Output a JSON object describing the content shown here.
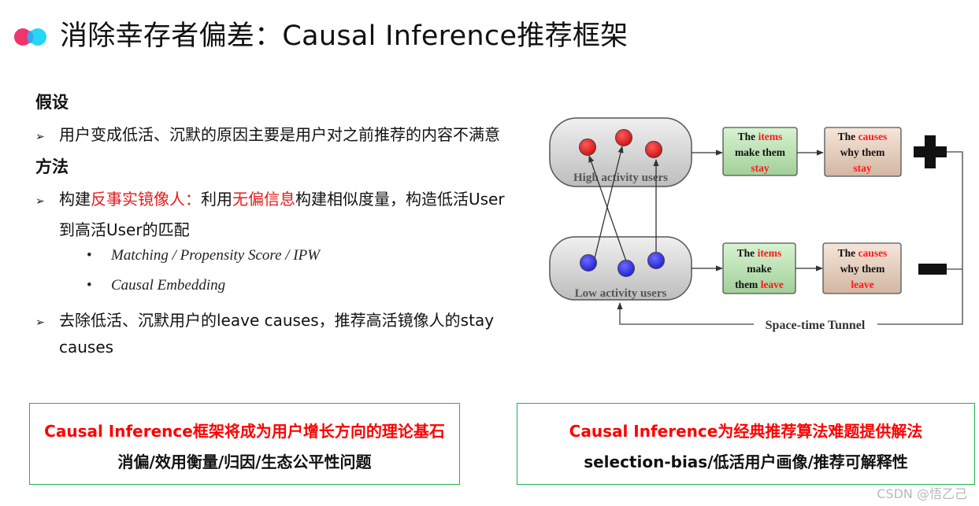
{
  "header": {
    "title": "消除幸存者偏差：Causal Inference推荐框架",
    "logo_colors": {
      "left": "#f0346c",
      "right": "#12d3f5"
    }
  },
  "left": {
    "assumption_heading": "假设",
    "assumption_item": "用户变成低活、沉默的原因主要是用户对之前推荐的内容不满意",
    "method_heading": "方法",
    "method_item1": {
      "part1": "构建",
      "part2_red": "反事实镜像人：",
      "part3": "利用",
      "part4_red": "无偏信息",
      "part5": "构建相似度量，构造低活User",
      "continuation": "到高活User的匹配"
    },
    "sub_items": [
      "Matching / Propensity Score / IPW",
      "Causal Embedding"
    ],
    "method_item2": {
      "line1": "去除低活、沉默用户的leave causes，推荐高活镜像人的stay",
      "continuation": "causes"
    },
    "bullet_arrow": "➢",
    "sub_bullet": "•"
  },
  "diagram": {
    "high_group_label": "High activity users",
    "low_group_label": "Low activity users",
    "stay_items": {
      "w1": "The ",
      "r1": "items",
      "w2": "make them",
      "r2": "stay"
    },
    "stay_causes": {
      "w1": "The ",
      "r1": "causes",
      "w2": "why them",
      "r2": "stay"
    },
    "leave_items": {
      "w1": "The ",
      "r1": "items",
      "w2": "make",
      "w3": "them ",
      "r2": "leave"
    },
    "leave_causes": {
      "w1": "The ",
      "r1": "causes",
      "w2": "why them",
      "r2": "leave"
    },
    "tunnel_label": "Space-time Tunnel",
    "plus_sign": "plus-icon",
    "minus_sign": "minus-icon",
    "colors": {
      "red_node": "#e01818",
      "blue_node": "#2f2fe0",
      "items_box": "#b8e0b0",
      "causes_box": "#e6d0bf",
      "highlight": "#ff1a1a"
    }
  },
  "bottom": {
    "left_box": {
      "line1": "Causal Inference框架将成为用户增长方向的理论基石",
      "line2": "消偏/效用衡量/归因/生态公平性问题"
    },
    "right_box": {
      "line1": "Causal Inference为经典推荐算法难题提供解法",
      "line2": "selection-bias/低活用户画像/推荐可解释性"
    }
  },
  "watermark": "CSDN @悟乙己"
}
